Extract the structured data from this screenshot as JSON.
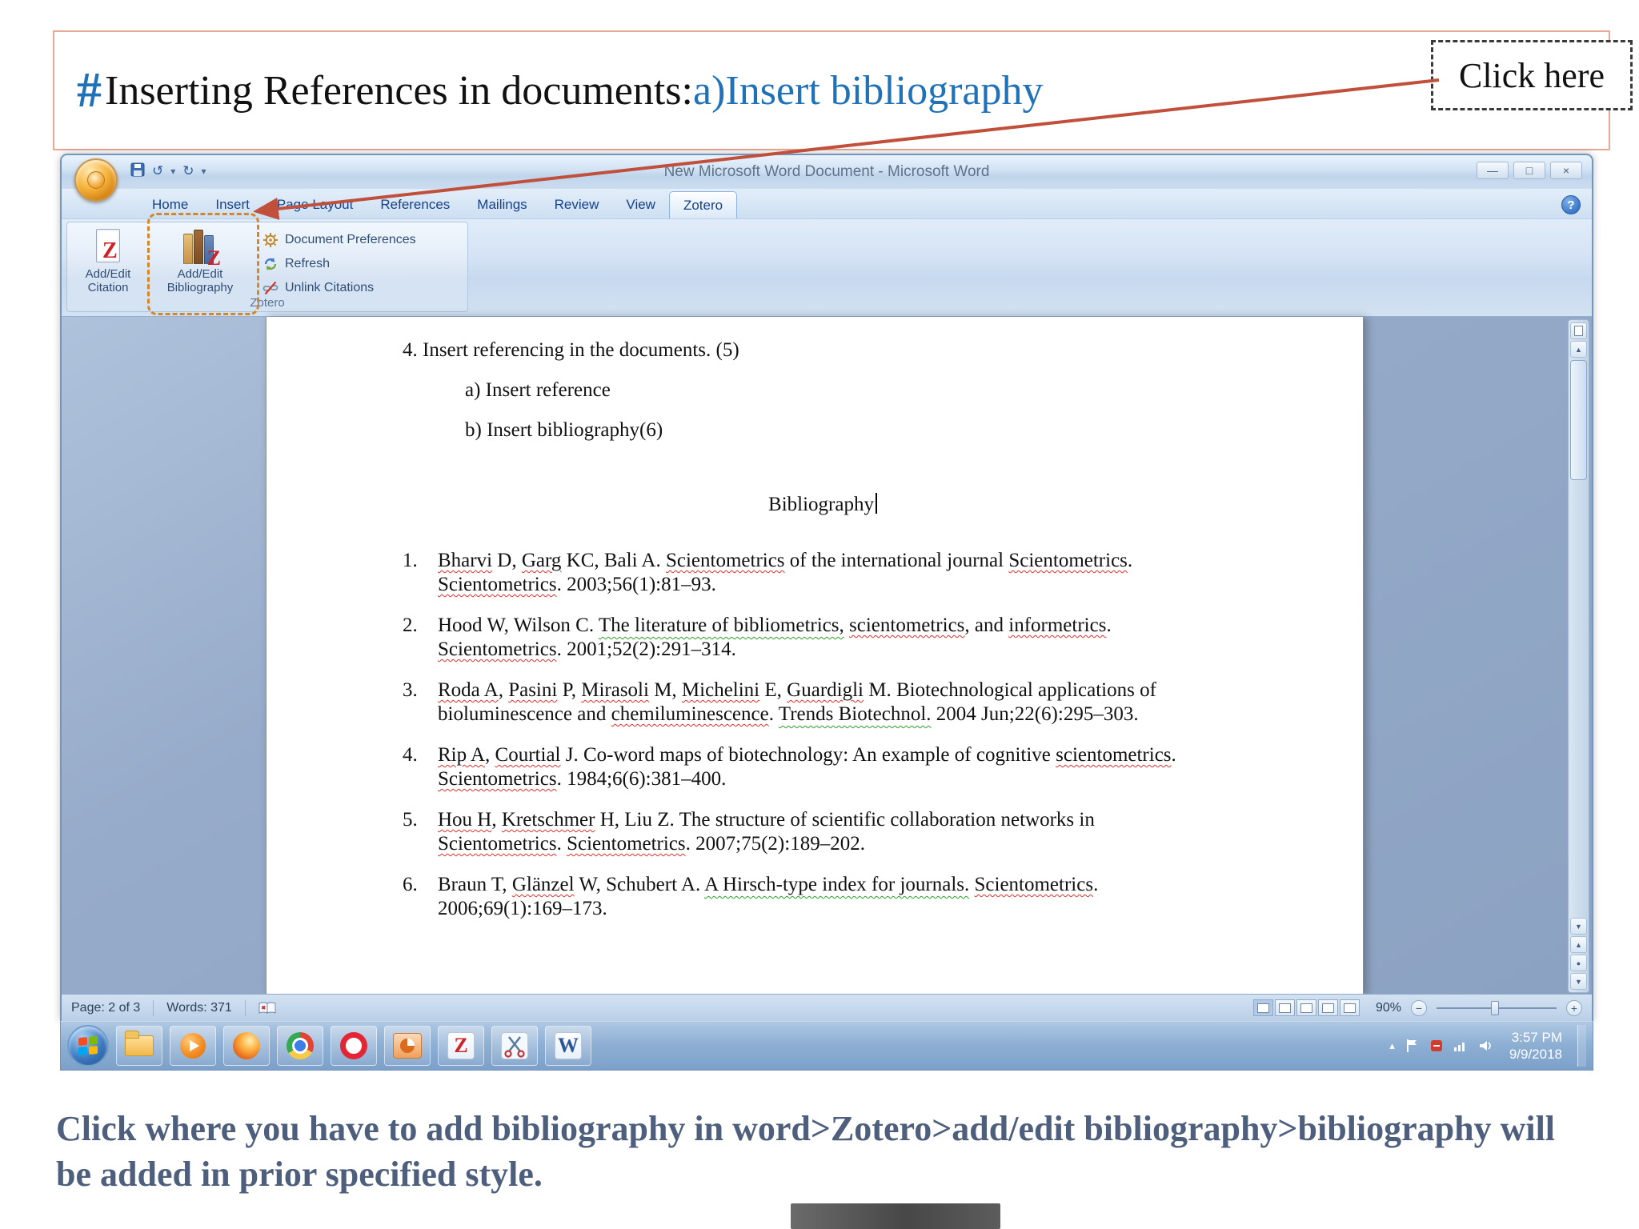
{
  "slide": {
    "title_hash": "#",
    "title_main": "Inserting References in documents: ",
    "title_accent": "a)Insert bibliography",
    "click_here": "Click here",
    "caption": "Click where you have to add bibliography in word>Zotero>add/edit bibliography>bibliography will be added in prior specified style."
  },
  "window": {
    "title": "New Microsoft Word Document - Microsoft Word",
    "tabs": [
      {
        "label": "Home"
      },
      {
        "label": "Insert"
      },
      {
        "label": "Page Layout"
      },
      {
        "label": "References"
      },
      {
        "label": "Mailings"
      },
      {
        "label": "Review"
      },
      {
        "label": "View"
      },
      {
        "label": "Zotero"
      }
    ],
    "ribbon": {
      "citation_line1": "Add/Edit",
      "citation_line2": "Citation",
      "bibliography_line1": "Add/Edit",
      "bibliography_line2": "Bibliography",
      "menu_items": [
        {
          "label": "Document Preferences"
        },
        {
          "label": "Refresh"
        },
        {
          "label": "Unlink Citations"
        }
      ],
      "group_label": "Zotero"
    }
  },
  "document": {
    "line1": "4. Insert referencing in the documents. (5)",
    "line2": "a) Insert reference",
    "line3": "b) Insert bibliography(6)",
    "heading": "Bibliography",
    "references": [
      {
        "num": "1.",
        "text": "Bharvi D, Garg KC, Bali A. Scientometrics of the international journal Scientometrics. Scientometrics. 2003;56(1):81–93."
      },
      {
        "num": "2.",
        "text": "Hood W, Wilson C. The literature of bibliometrics, scientometrics, and informetrics. Scientometrics. 2001;52(2):291–314."
      },
      {
        "num": "3.",
        "text": "Roda A, Pasini P, Mirasoli M, Michelini E, Guardigli M. Biotechnological applications of bioluminescence and chemiluminescence. Trends Biotechnol. 2004 Jun;22(6):295–303."
      },
      {
        "num": "4.",
        "text": "Rip A, Courtial J. Co-word maps of biotechnology: An example of cognitive scientometrics. Scientometrics. 1984;6(6):381–400."
      },
      {
        "num": "5.",
        "text": "Hou H, Kretschmer H, Liu Z. The structure of scientific collaboration networks in Scientometrics. Scientometrics. 2007;75(2):189–202."
      },
      {
        "num": "6.",
        "text": "Braun T, Glänzel W, Schubert A. A Hirsch-type index for journals. Scientometrics. 2006;69(1):169–173."
      }
    ],
    "spellcheck": {
      "red": [
        "Bharvi",
        "Garg",
        "Scientometrics",
        "scientometrics",
        "informetrics",
        "Roda A",
        "Pasini",
        "Mirasoli",
        "Michelini",
        "Guardigli",
        "chemiluminescence",
        "Courtial",
        "Kretschmer",
        "Glänzel",
        "Hou H",
        "Rip A"
      ],
      "green": [
        "The literature of bibliometrics,",
        "Trends Biotechnol.",
        "A Hirsch-type index for journals."
      ]
    }
  },
  "status_bar": {
    "page": "Page: 2 of 3",
    "words": "Words: 371",
    "zoom": "90%"
  },
  "taskbar": {
    "time": "3:57 PM",
    "date": "9/9/2018"
  },
  "glyphs": {
    "z": "Z",
    "w": "W",
    "minimize": "—",
    "maximize": "□",
    "close": "×",
    "help": "?",
    "undo": "↺",
    "redo": "↻",
    "dropdown": "▾",
    "zoom_out": "−",
    "zoom_in": "+",
    "up": "▲",
    "down": "▼",
    "dot": "●",
    "tray_chevron": "▴"
  }
}
